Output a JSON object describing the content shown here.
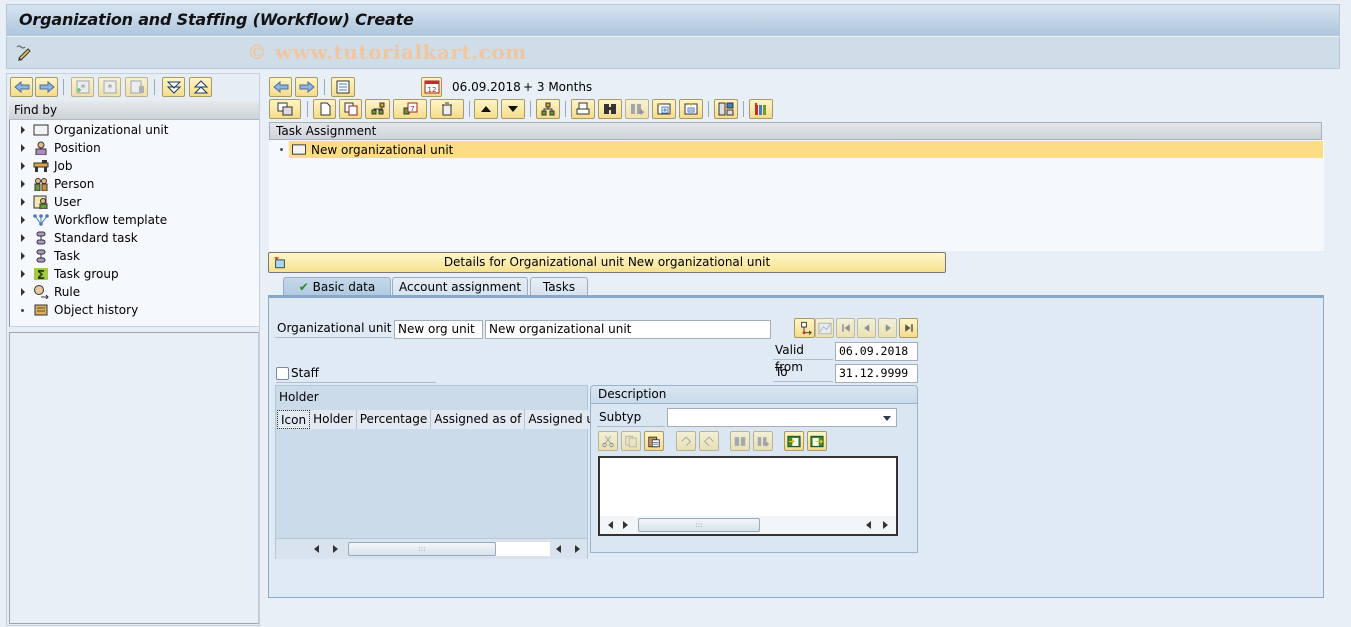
{
  "window": {
    "title": "Organization and Staffing (Workflow) Create",
    "watermark": "© www.tutorialkart.com"
  },
  "left_panel": {
    "toolbar": [
      "back",
      "forward",
      "create-search",
      "search",
      "delete-search",
      "expand-all",
      "collapse-all"
    ],
    "find_by_label": "Find by",
    "tree": [
      {
        "label": "Organizational unit",
        "icon": "org-unit-icon",
        "expandable": true
      },
      {
        "label": "Position",
        "icon": "position-icon",
        "expandable": true
      },
      {
        "label": "Job",
        "icon": "job-icon",
        "expandable": true
      },
      {
        "label": "Person",
        "icon": "person-icon",
        "expandable": true
      },
      {
        "label": "User",
        "icon": "user-icon",
        "expandable": true
      },
      {
        "label": "Workflow template",
        "icon": "workflow-template-icon",
        "expandable": true
      },
      {
        "label": "Standard task",
        "icon": "standard-task-icon",
        "expandable": true
      },
      {
        "label": "Task",
        "icon": "task-icon",
        "expandable": true
      },
      {
        "label": "Task group",
        "icon": "task-group-icon",
        "expandable": true
      },
      {
        "label": "Rule",
        "icon": "rule-icon",
        "expandable": true
      },
      {
        "label": "Object history",
        "icon": "object-history-icon",
        "expandable": false
      }
    ]
  },
  "main": {
    "date_label": "06.09.2018",
    "period_label": "+ 3 Months",
    "task_assignment_header": "Task Assignment",
    "task_row": "New organizational unit",
    "details_bar": "Details for Organizational unit New organizational unit",
    "tabs": [
      {
        "label": "Basic data",
        "active": true
      },
      {
        "label": "Account assignment",
        "active": false
      },
      {
        "label": "Tasks",
        "active": false
      }
    ],
    "basic_data": {
      "org_unit_label": "Organizational unit",
      "org_unit_short": "New org unit",
      "org_unit_long": "New organizational unit",
      "valid_from_label": "Valid from",
      "valid_from": "06.09.2018",
      "to_label": "To",
      "to": "31.12.9999",
      "staff_label": "Staff",
      "staff_checked": false,
      "holder": {
        "title": "Holder",
        "columns": [
          "Icon",
          "Holder",
          "Percentage",
          "Assigned as of",
          "Assigned unti"
        ]
      },
      "description": {
        "title": "Description",
        "subtyp_label": "Subtyp",
        "subtyp_value": ""
      }
    }
  }
}
